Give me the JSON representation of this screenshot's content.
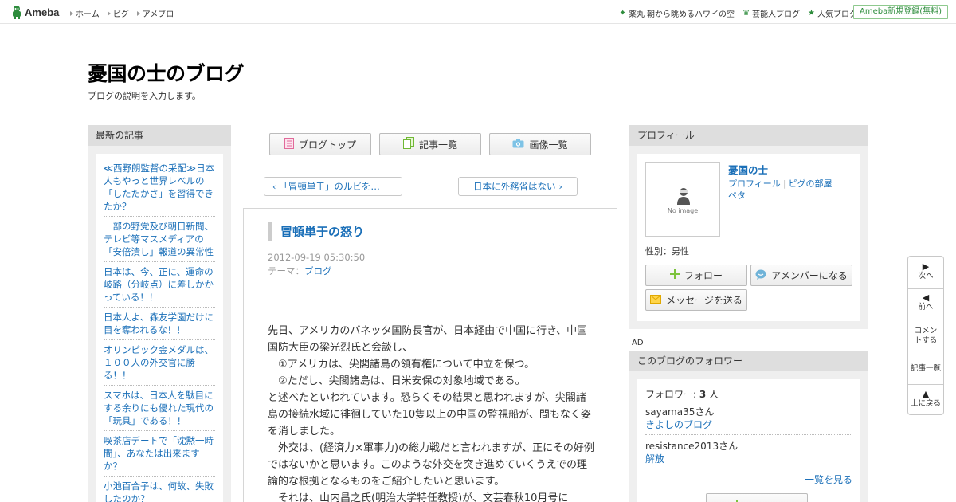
{
  "topbar": {
    "logo_text": "Ameba",
    "nav": [
      "ホーム",
      "ピグ",
      "アメブロ"
    ],
    "links": [
      {
        "label": "薬丸 朝から眺めるハワイの空",
        "icon": "sparkle-icon"
      },
      {
        "label": "芸能人ブログ",
        "icon": "crown-icon"
      },
      {
        "label": "人気ブログ",
        "icon": "star-icon"
      }
    ],
    "register": "Ameba新規登録(無料)"
  },
  "blog": {
    "title": "憂国の士のブログ",
    "description": "ブログの説明を入力します。"
  },
  "left_sidebar": {
    "heading": "最新の記事",
    "items": [
      "≪西野朗監督の采配≫日本人もやっと世界レベルの「したたかさ」を習得できたか？",
      "一部の野党及び朝日新聞、テレビ等マスメディアの「安倍潰し」報道の異常性",
      "日本は、今、正に、運命の岐路（分岐点）に差しかかっている！！",
      "日本人よ、森友学園だけに目を奪われるな！！",
      "オリンピック金メダルは、１００人の外交官に勝る！！",
      "スマホは、日本人を駄目にする余りにも優れた現代の「玩具」である！！",
      "喫茶店デートで「沈黙一時間」、あなたは出来ますか？",
      "小池百合子は、何故、失敗したのか？"
    ]
  },
  "toolbar": {
    "blog_top": "ブログトップ",
    "articles": "記事一覧",
    "images": "画像一覧"
  },
  "pager": {
    "prev": "「冒頓単于」のルビを…",
    "next": "日本に外務省はない"
  },
  "article": {
    "title": "冒頓単于の怒り",
    "date": "2012-09-19 05:30:50",
    "theme_label": "テーマ：",
    "theme": "ブログ",
    "paragraphs": [
      "先日、アメリカのパネッタ国防長官が、日本経由で中国に行き、中国国防大臣の梁光烈氏と会談し、",
      "　①アメリカは、尖閣諸島の領有権について中立を保つ。",
      "　②ただし、尖閣諸島は、日米安保の対象地域である。",
      "と述べたといわれています。恐らくその結果と思われますが、尖閣諸島の接続水域に徘徊していた10隻以上の中国の監視船が、間もなく姿を消しました。",
      "　外交は、(経済力×軍事力)の総力戦だと言われますが、正にその好例ではないかと思います。このような外交を突き進めていくうえでの理論的な根拠となるものをご紹介したいと思います。",
      "　それは、山内昌之氏(明治大学特任教授)が、文芸春秋10月号に"
    ]
  },
  "profile": {
    "heading": "プロフィール",
    "avatar_label": "No image",
    "name": "憂国の士",
    "link_profile": "プロフィール",
    "link_pig": "ピグの部屋",
    "link_peta": "ペタ",
    "gender": "性別：男性",
    "follow": "フォロー",
    "amember": "アメンバーになる",
    "message": "メッセージを送る"
  },
  "ad_label": "AD",
  "followers": {
    "heading": "このブログのフォロワー",
    "count_label": "フォロワー: ",
    "count": "3",
    "count_unit": " 人",
    "items": [
      {
        "user": "sayama35さん",
        "blog": "きよしのブログ"
      },
      {
        "user": "resistance2013さん",
        "blog": "解放"
      }
    ],
    "see_all": "一覧を見る"
  },
  "floatnav": {
    "next": "次へ",
    "prev": "前へ",
    "comment": "コメントする",
    "list": "記事一覧",
    "top": "上に戻る"
  },
  "colors": {
    "link": "#1a6fb8",
    "green": "#2d8c3c",
    "panel": "#efefef",
    "panel_head": "#dedede"
  }
}
